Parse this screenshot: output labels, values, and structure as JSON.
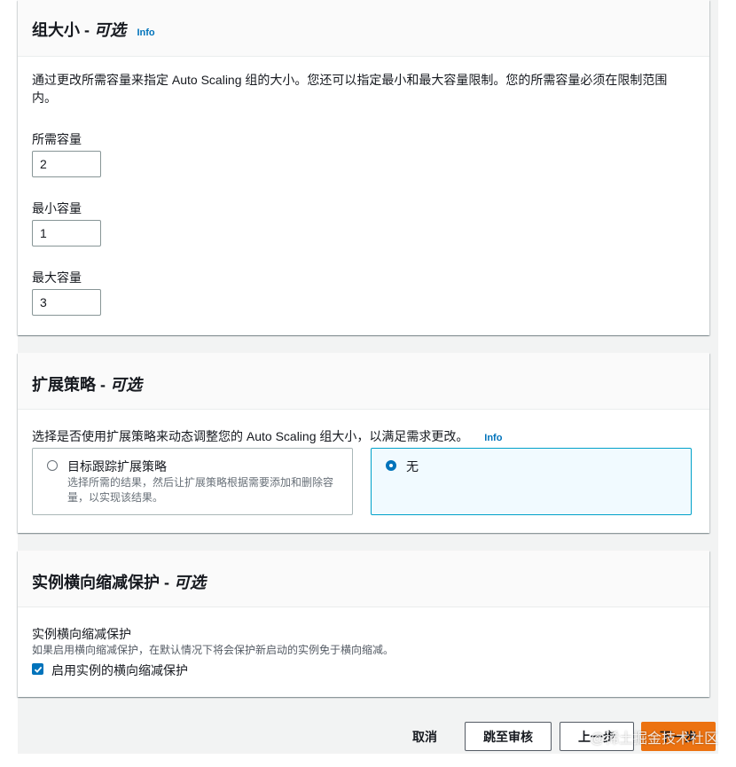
{
  "group_size": {
    "title": "组大小 - ",
    "title_optional": "可选",
    "info": "Info",
    "description": "通过更改所需容量来指定 Auto Scaling 组的大小。您还可以指定最小和最大容量限制。您的所需容量必须在限制范围内。",
    "desired_label": "所需容量",
    "desired_value": "2",
    "min_label": "最小容量",
    "min_value": "1",
    "max_label": "最大容量",
    "max_value": "3"
  },
  "scaling_policy": {
    "title": "扩展策略 - ",
    "title_optional": "可选",
    "description": "选择是否使用扩展策略来动态调整您的 Auto Scaling 组大小，以满足需求更改。",
    "info": "Info",
    "options": [
      {
        "label": "目标跟踪扩展策略",
        "sub": "选择所需的结果，然后让扩展策略根据需要添加和删除容量，以实现该结果。",
        "selected": false
      },
      {
        "label": "无",
        "selected": true
      }
    ]
  },
  "scale_in_protection": {
    "title": "实例横向缩减保护 - ",
    "title_optional": "可选",
    "field_label": "实例横向缩减保护",
    "field_description": "如果启用横向缩减保护，在默认情况下将会保护新启动的实例免于横向缩减。",
    "checkbox_label": "启用实例的横向缩减保护",
    "checked": true
  },
  "footer": {
    "cancel": "取消",
    "skip_to_review": "跳至审核",
    "previous": "上一步",
    "next": "下一步"
  },
  "watermark": "@稀土掘金技术社区",
  "colors": {
    "accent": "#0073bb",
    "primary_button": "#ec7211",
    "selected_card": "#f1faff"
  }
}
